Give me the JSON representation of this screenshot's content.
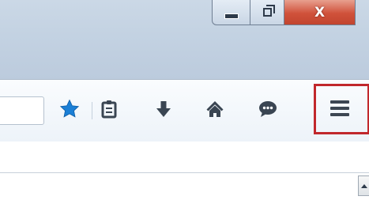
{
  "window": {
    "caption_buttons": {
      "minimize": {
        "icon": "minimize-icon"
      },
      "maximize": {
        "icon": "restore-icon"
      },
      "close": {
        "label": "X",
        "icon": "close-icon"
      }
    }
  },
  "toolbar": {
    "buttons": [
      {
        "name": "bookmark-star",
        "icon": "star-icon",
        "color": "#1b7fd6"
      },
      {
        "name": "bookmarks-menu",
        "icon": "clipboard-icon",
        "color": "#3a4552"
      },
      {
        "name": "downloads",
        "icon": "download-arrow-icon",
        "color": "#3a4552"
      },
      {
        "name": "home",
        "icon": "home-icon",
        "color": "#3a4552"
      },
      {
        "name": "chat",
        "icon": "chat-bubble-icon",
        "color": "#3a4552"
      },
      {
        "name": "open-menu",
        "icon": "hamburger-menu-icon",
        "color": "#3c4652",
        "highlight_color": "#c1282c"
      }
    ]
  }
}
